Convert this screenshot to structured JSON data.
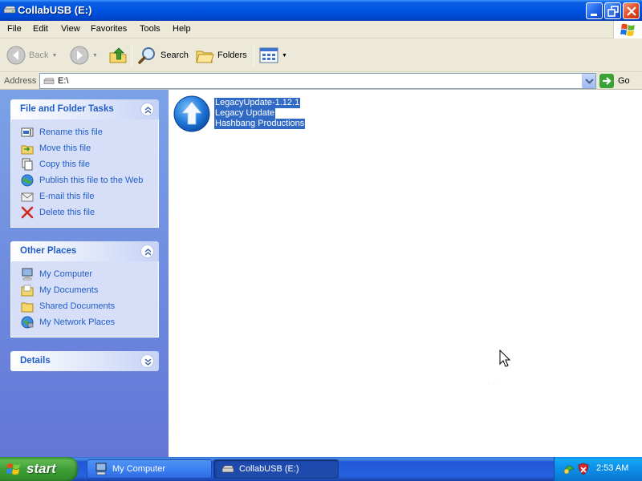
{
  "window": {
    "title": "CollabUSB (E:)"
  },
  "menu": {
    "items": [
      "File",
      "Edit",
      "View",
      "Favorites",
      "Tools",
      "Help"
    ]
  },
  "toolbar": {
    "back_label": "Back",
    "search_label": "Search",
    "folders_label": "Folders"
  },
  "address": {
    "label": "Address",
    "value": "E:\\",
    "go_label": "Go"
  },
  "tasks_panel": {
    "title": "File and Folder Tasks",
    "items": [
      {
        "label": "Rename this file",
        "icon": "rename-icon"
      },
      {
        "label": "Move this file",
        "icon": "move-icon"
      },
      {
        "label": "Copy this file",
        "icon": "copy-icon"
      },
      {
        "label": "Publish this file to the Web",
        "icon": "publish-icon"
      },
      {
        "label": "E-mail this file",
        "icon": "email-icon"
      },
      {
        "label": "Delete this file",
        "icon": "delete-icon"
      }
    ]
  },
  "places_panel": {
    "title": "Other Places",
    "items": [
      {
        "label": "My Computer",
        "icon": "computer-icon"
      },
      {
        "label": "My Documents",
        "icon": "documents-icon"
      },
      {
        "label": "Shared Documents",
        "icon": "folder-icon"
      },
      {
        "label": "My Network Places",
        "icon": "network-icon"
      }
    ]
  },
  "details_panel": {
    "title": "Details"
  },
  "file": {
    "name": "LegacyUpdate-1.12.1",
    "description": "Legacy Update",
    "company": "Hashbang Productions",
    "selected": true
  },
  "taskbar": {
    "start_label": "start",
    "buttons": [
      {
        "label": "My Computer",
        "active": false
      },
      {
        "label": "CollabUSB (E:)",
        "active": true
      }
    ],
    "clock": "2:53 AM"
  },
  "colors": {
    "titlebar": "#0054e3",
    "taskpane": "#7ba2e7",
    "link": "#215dc6",
    "selection": "#316ac5",
    "start_green": "#3c9b35"
  }
}
